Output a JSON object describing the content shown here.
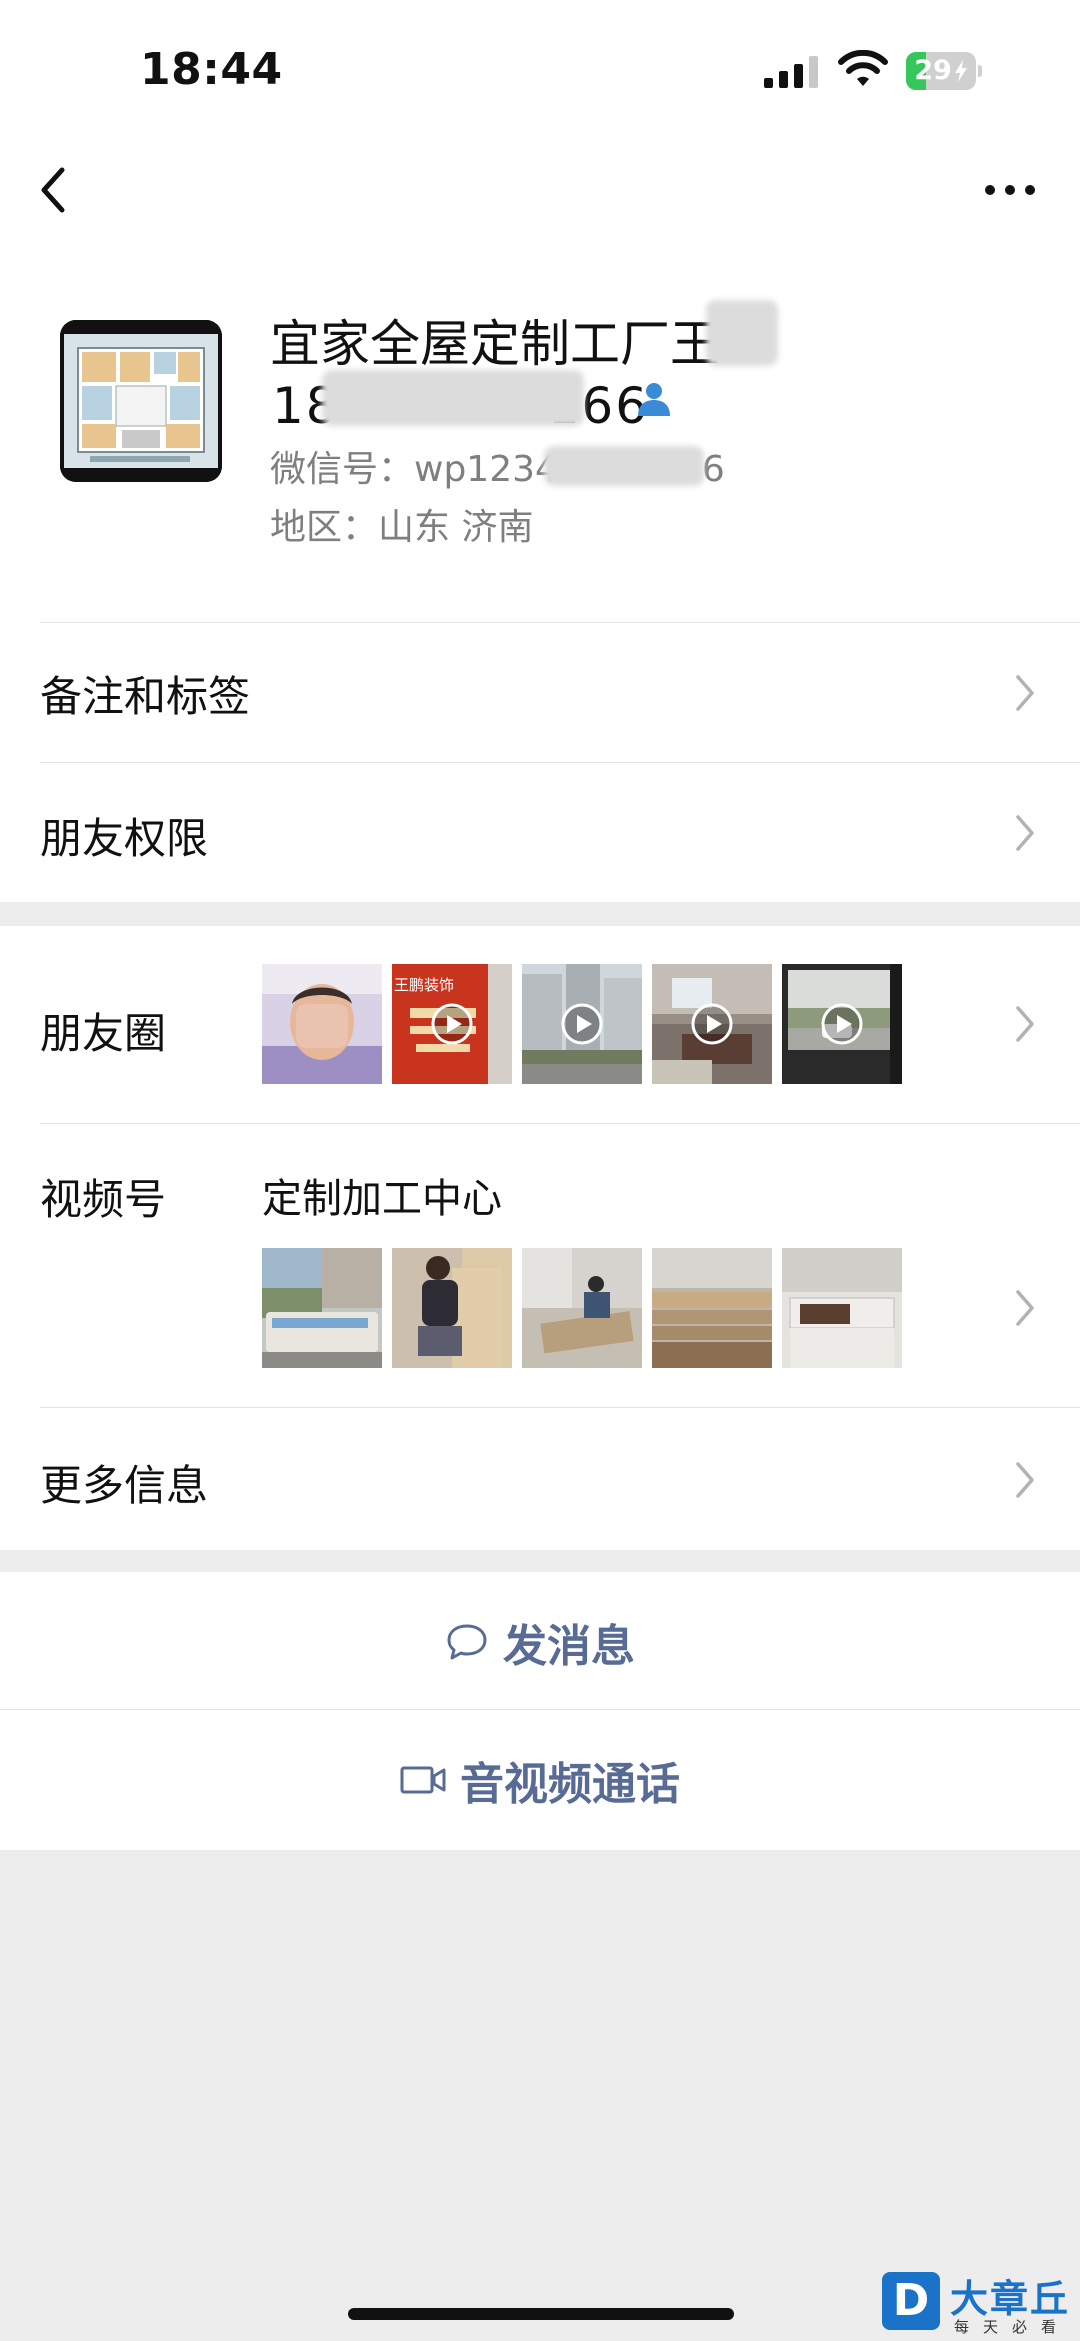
{
  "status_bar": {
    "time": "18:44",
    "battery": "29",
    "battery_level": 0.29,
    "battery_color": "#34c759"
  },
  "nav": {
    "back_icon": "chevron-left-icon",
    "more_icon": "more-horizontal-icon"
  },
  "profile": {
    "name": "宜家全屋定制工厂王",
    "phone": "18　　　　166",
    "wechat_id": "微信号：wp1234　　　　6",
    "region": "地区：山东 济南"
  },
  "rows": {
    "remarks": "备注和标签",
    "permissions": "朋友权限",
    "moments": "朋友圈",
    "channels": "视频号",
    "channel_name": "定制加工中心",
    "more_info": "更多信息"
  },
  "moments_thumbs": [
    {
      "desc": "face-photo",
      "video": false
    },
    {
      "desc": "red-sign-王鹏装饰",
      "video": true
    },
    {
      "desc": "apartment-buildings",
      "video": true
    },
    {
      "desc": "room-interior",
      "video": true
    },
    {
      "desc": "car-window-street",
      "video": true
    }
  ],
  "moments_sign_text": "王鹏装饰",
  "actions": {
    "message": "发消息",
    "call": "音视频通话"
  },
  "colors": {
    "action_blue": "#576b95",
    "page_bg": "#ededed",
    "contact_icon_blue": "#3a8bd6"
  },
  "watermark": {
    "logo": "D",
    "title": "大章丘",
    "subtitle": "每天必看"
  }
}
